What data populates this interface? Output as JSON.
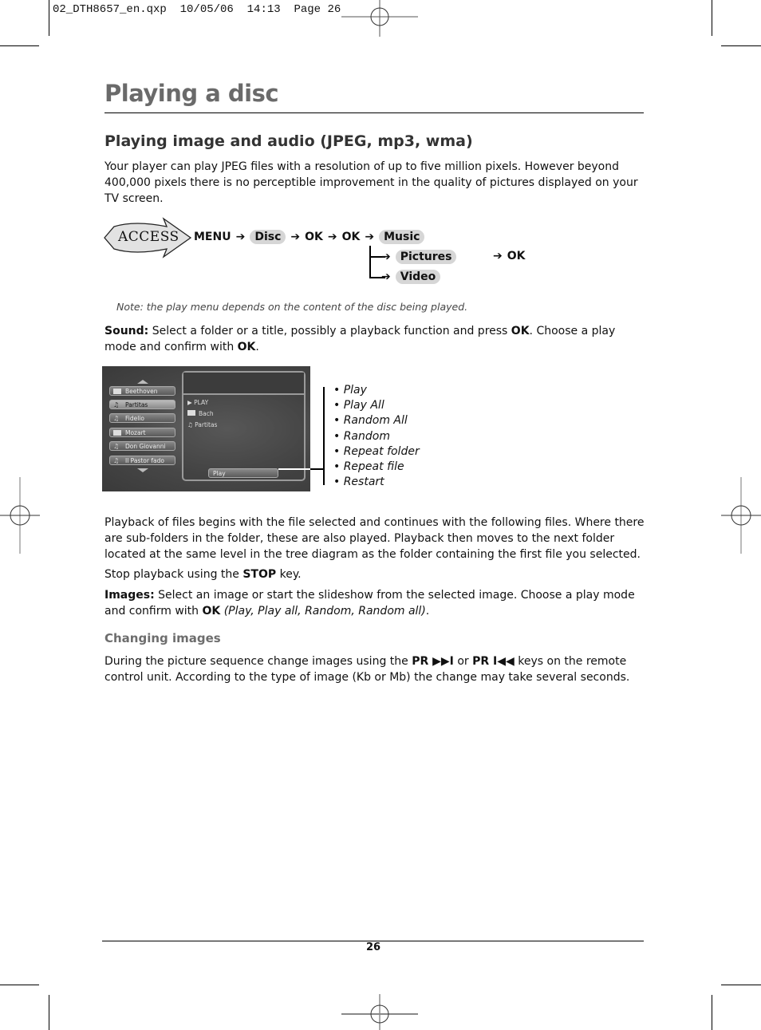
{
  "slug": "02_DTH8657_en.qxp  10/05/06  14:13  Page 26",
  "page_title": "Playing a disc",
  "section_title": "Playing image and audio (JPEG, mp3, wma)",
  "intro": "Your player can play JPEG files with a resolution of up to five million pixels. However beyond 400,000 pixels there is no perceptible improvement in the quality of pictures displayed on your TV screen.",
  "access": {
    "badge_label": "ACCESS",
    "arrow_glyph": "➔",
    "menu": "MENU",
    "disc": "Disc",
    "ok1": "OK",
    "ok2": "OK",
    "options": [
      "Music",
      "Pictures",
      "Video"
    ],
    "final_ok": "OK"
  },
  "note": "Note: the play menu depends on the content of the disc being played.",
  "sound": {
    "label": "Sound:",
    "text1": " Select a folder or a title, possibly a playback function and press ",
    "ok": "OK",
    "text2": ". Choose a play mode and confirm with ",
    "ok2": "OK",
    "text3": "."
  },
  "tv_screen": {
    "folders": [
      "Beethoven",
      "Partitas",
      "Fidelio",
      "Mozart",
      "Don Giovanni",
      "Il Pastor fado"
    ],
    "selected_index": 1,
    "panel_items": [
      "PLAY",
      "Bach",
      "Partitas"
    ],
    "play_button": "Play"
  },
  "play_modes": [
    "• Play",
    "• Play All",
    "• Random All",
    "• Random",
    "• Repeat folder",
    "• Repeat file",
    "• Restart"
  ],
  "playback_para": "Playback of files begins with the file selected and continues with the following files. Where there are sub-folders in the folder, these are also played. Playback then moves to the next folder located at the same level in the tree diagram as the folder containing the first file you selected.",
  "stop": {
    "text1": "Stop playback using the ",
    "key": "STOP",
    "text2": " key."
  },
  "images": {
    "label": "Images:",
    "text1": " Select an image or start the slideshow from the selected image. Choose a play mode and confirm with ",
    "ok": "OK",
    "modes": " (Play, Play all, Random, Random all)",
    "end": "."
  },
  "changing_title": "Changing images",
  "changing": {
    "text1": "During the picture sequence change images using the ",
    "pr1": "PR ▶▶I",
    "or": " or ",
    "pr2": "PR I◀◀",
    "text2": " keys on the remote control unit. According to the type of image (Kb or Mb) the change may take several seconds."
  },
  "page_number": "26"
}
